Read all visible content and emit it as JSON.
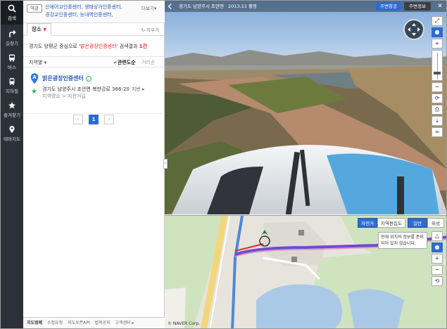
{
  "rail": {
    "items": [
      {
        "label": "검색",
        "icon": "search-icon",
        "active": true
      },
      {
        "label": "길찾기",
        "icon": "route-icon"
      },
      {
        "label": "버스",
        "icon": "bus-icon"
      },
      {
        "label": "지하철",
        "icon": "subway-icon"
      },
      {
        "label": "즐겨찾기",
        "icon": "star-icon"
      },
      {
        "label": "테마지도",
        "icon": "map-pin-icon"
      }
    ]
  },
  "recent": {
    "tag": "역관",
    "links": [
      "산에어교인중센터,",
      "생태상거인중센터,",
      "경강교인중센터,",
      "능내역인중센터,"
    ],
    "more": "더보기▾"
  },
  "tabs": {
    "place_label": "장소",
    "clear_label": "지우기"
  },
  "summary": {
    "prefix": "경기도 양평군 중심으로 '",
    "keyword": "밝은광장인증센터",
    "middle": "' 검색결과 ",
    "count": "1건"
  },
  "sort": {
    "region": "지역별 ▾",
    "relevance": "관련도순",
    "distance": "거리순"
  },
  "result": {
    "title": "밝은광장인증센터",
    "address": "경기도 남양주시 조안면 북한강로 366-20",
    "map_link": "지번 ▸",
    "category": "지역명소 > 자전거길"
  },
  "pager": {
    "prev": "‹",
    "current": "1",
    "next": "›"
  },
  "footer": {
    "title": "지도범례",
    "items": [
      "수정요청",
      "지도오픈API",
      "법적공지",
      "고객센터 ▸"
    ]
  },
  "streetview": {
    "location": "경기도 남양주시 조안면",
    "date": "2013.11 촬영",
    "btn_around": "주변항공",
    "btn_info": "주변정보",
    "close": "✕",
    "zoom_in": "+",
    "zoom_out": "−"
  },
  "minimap": {
    "modes": [
      "자전거",
      "지역편집도",
      "일반",
      "위성"
    ],
    "tip": "현재 위치의 정보를 준비되어 있지 않습니다.",
    "copyright": "© NAVER Corp.",
    "zoom_in": "+",
    "zoom_out": "−"
  },
  "colors": {
    "rail_bg": "#2c3038",
    "accent_blue": "#2f6bd0",
    "link_blue": "#2c58b6",
    "keyword_red": "#e02b2b",
    "badge_green": "#2bb24c"
  }
}
